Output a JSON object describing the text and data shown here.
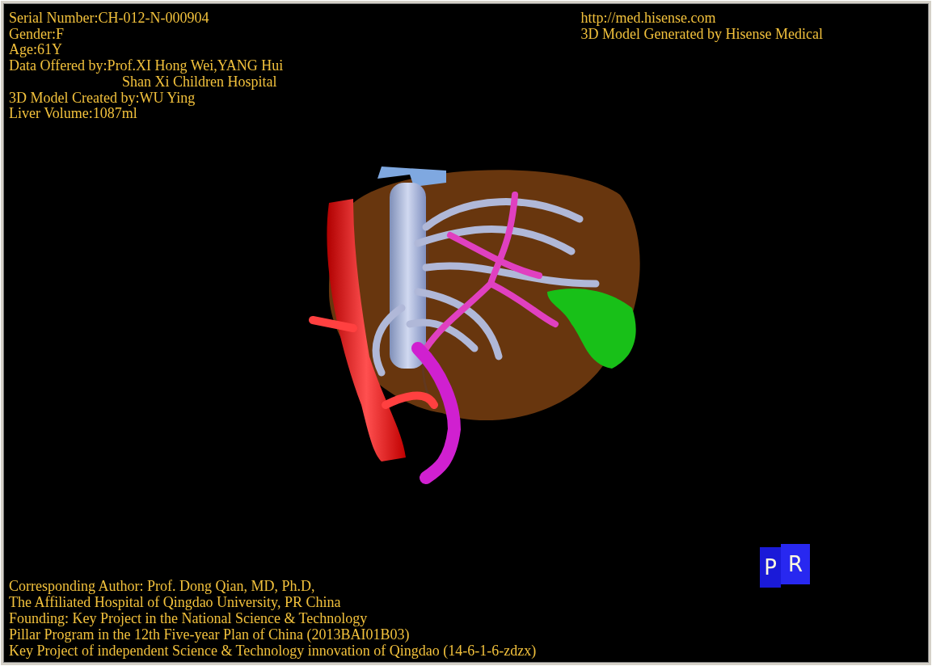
{
  "header": {
    "info_lines": [
      {
        "kind": "line",
        "text": "Serial Number:CH-012-N-000904"
      },
      {
        "kind": "line",
        "text": "Gender:F"
      },
      {
        "kind": "line",
        "text": "Age:61Y"
      },
      {
        "kind": "line",
        "text": "Data Offered by:Prof.XI Hong Wei,YANG Hui"
      },
      {
        "kind": "continuation",
        "text": "Shan Xi Children Hospital"
      },
      {
        "kind": "line",
        "text": "3D Model Created by:WU Ying"
      },
      {
        "kind": "line",
        "text": "Liver Volume:1087ml"
      }
    ],
    "credit_lines": [
      "http://med.hisense.com",
      "3D Model Generated by Hisense Medical"
    ]
  },
  "footer": {
    "lines": [
      "Corresponding Author: Prof. Dong Qian, MD, Ph.D,",
      "The Affiliated Hospital of Qingdao University, PR China",
      "Founding: Key Project in the National Science & Technology",
      "Pillar Program in the 12th Five-year Plan of China (2013BAI01B03)",
      "Key Project of independent Science & Technology innovation of Qingdao (14-6-1-6-zdzx)"
    ]
  },
  "orientation_cube": {
    "faces": [
      "P",
      "R"
    ]
  }
}
